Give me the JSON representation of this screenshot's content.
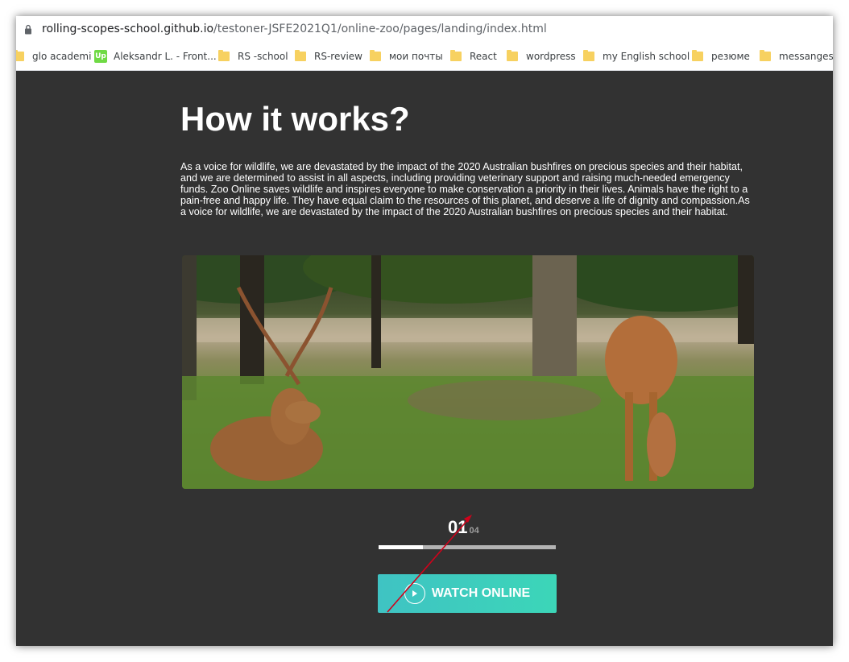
{
  "browser": {
    "url_host": "rolling-scopes-school.github.io",
    "url_path": "/testoner-JSFE2021Q1/online-zoo/pages/landing/index.html",
    "bookmarks": [
      {
        "label": "glo academi",
        "icon": "folder-icon"
      },
      {
        "label": "Aleksandr L. - Front...",
        "icon": "upwork-icon",
        "icon_text": "Up"
      },
      {
        "label": "RS -school",
        "icon": "folder-icon"
      },
      {
        "label": "RS-review",
        "icon": "folder-icon"
      },
      {
        "label": "мои почты",
        "icon": "folder-icon"
      },
      {
        "label": "React",
        "icon": "folder-icon"
      },
      {
        "label": "wordpress",
        "icon": "folder-icon"
      },
      {
        "label": "my English school",
        "icon": "folder-icon"
      },
      {
        "label": "резюме",
        "icon": "folder-icon"
      },
      {
        "label": "messanges",
        "icon": "folder-icon"
      }
    ]
  },
  "section": {
    "title": "How it works?",
    "description": "As a voice for wildlife, we are devastated by the impact of the 2020 Australian bushfires on precious species and their habitat, and we are determined to assist in all aspects, including providing veterinary support and raising much-needed emergency funds. Zoo Online saves wildlife and inspires everyone to make conservation a priority in their lives. Animals have the right to a pain-free and happy life. They have equal claim to the resources of this planet, and deserve a life of dignity and compassion.As a voice for wildlife, we are devastated by the impact of the 2020 Australian bushfires on precious species and their habitat.",
    "image": "deer-photo",
    "slider": {
      "current": "01",
      "total": "04",
      "progress_fraction": 0.25
    },
    "watch_button": {
      "label": "WATCH ONLINE",
      "icon": "play-icon"
    }
  },
  "colors": {
    "page_background": "#323232",
    "button_gradient_start": "#3fc3c3",
    "button_gradient_end": "#3cd6b8",
    "annotation_arrow": "#d0021b"
  }
}
